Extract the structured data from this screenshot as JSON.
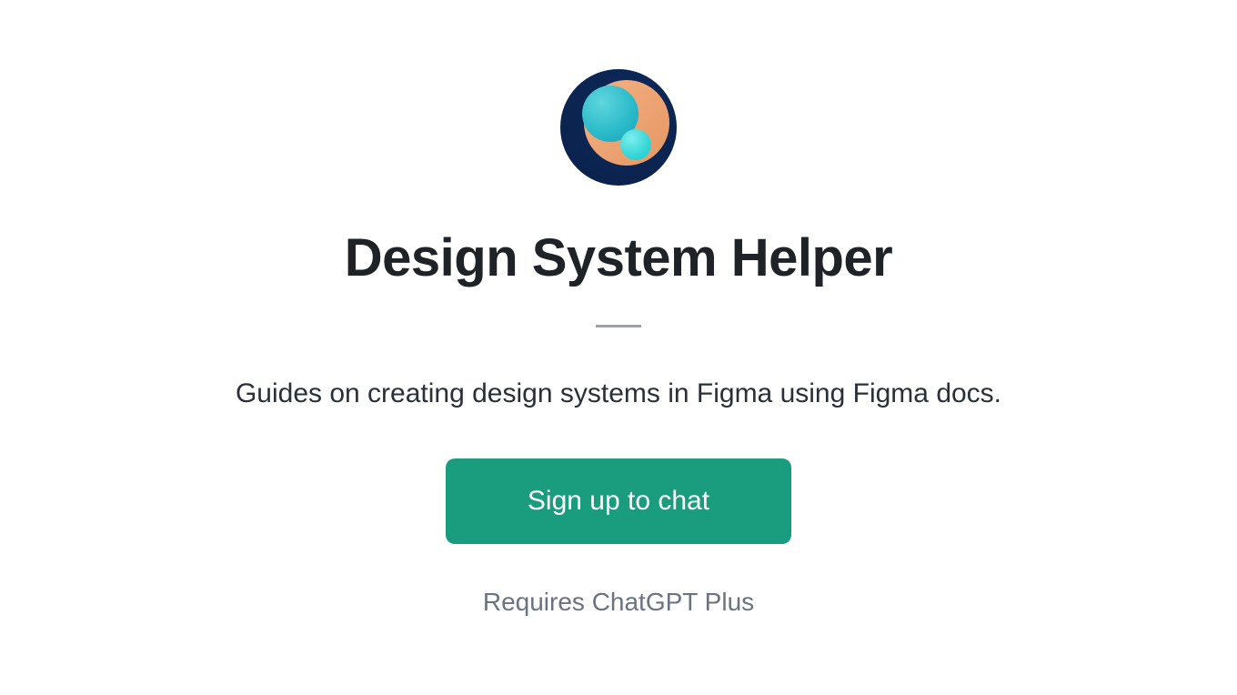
{
  "app": {
    "title": "Design System Helper",
    "description": "Guides on creating design systems in Figma using Figma docs.",
    "cta_label": "Sign up to chat",
    "requires_text": "Requires ChatGPT Plus"
  }
}
